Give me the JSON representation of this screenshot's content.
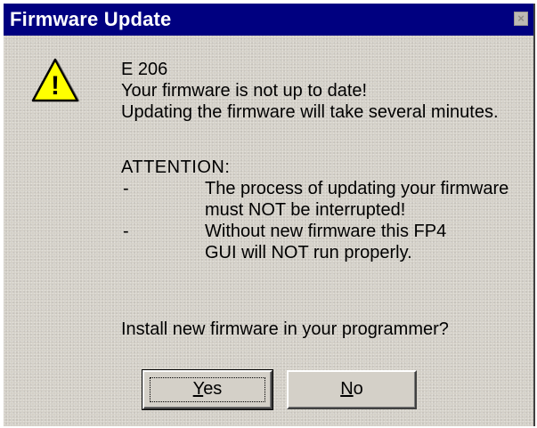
{
  "window": {
    "title": "Firmware Update",
    "close_glyph": "×"
  },
  "icon": {
    "name": "warning-icon",
    "glyph": "!",
    "fill": "#ffff00"
  },
  "message": {
    "code": "E 206",
    "line1": "Your firmware is not up to date!",
    "line2": "Updating the firmware will take several minutes.",
    "attention_heading": "ATTENTION:",
    "bullets": [
      {
        "dash": "-",
        "lines": [
          "The process of updating your firmware",
          "must NOT be interrupted!"
        ]
      },
      {
        "dash": "-",
        "lines": [
          "Without new firmware this FP4",
          "GUI will NOT run properly."
        ]
      }
    ],
    "question": "Install new firmware in your programmer?"
  },
  "buttons": {
    "yes": {
      "accel": "Y",
      "rest": "es"
    },
    "no": {
      "accel": "N",
      "rest": "o"
    }
  },
  "colors": {
    "titlebar": "#000080",
    "dialog_bg": "#d4d0c8"
  }
}
